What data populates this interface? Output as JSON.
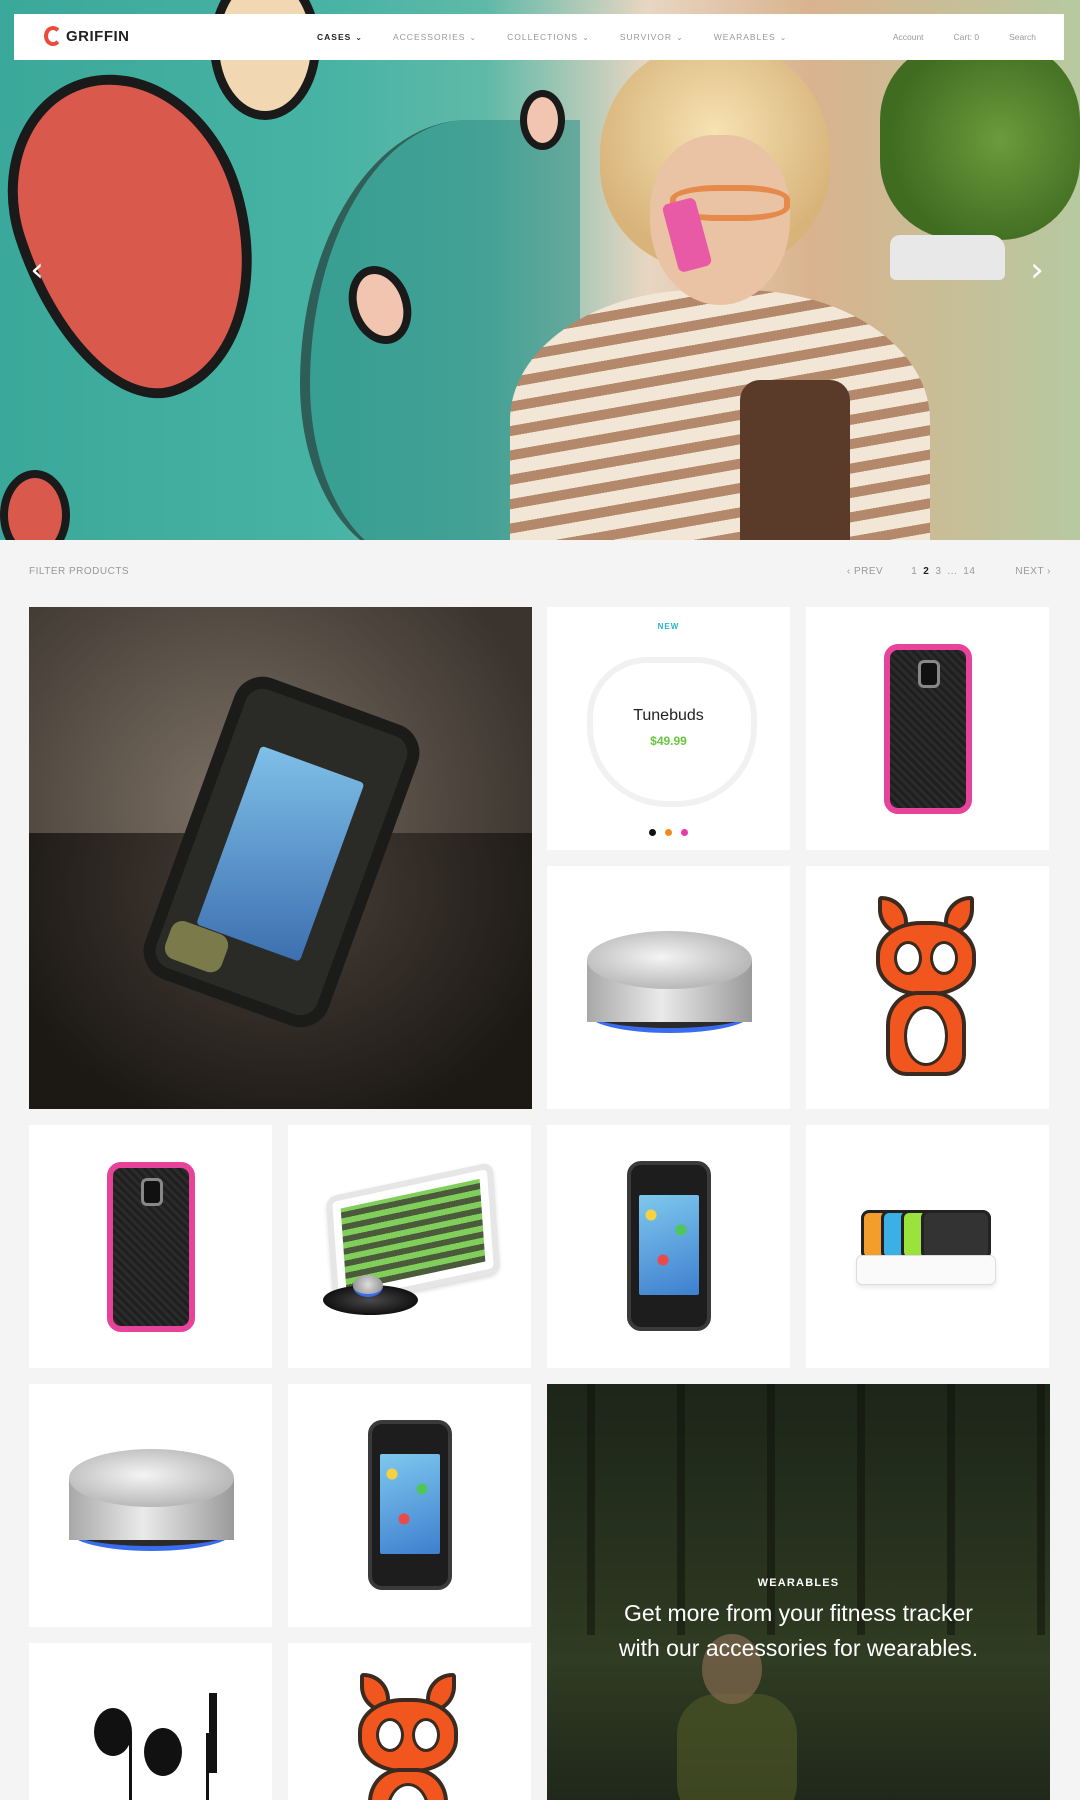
{
  "brand": {
    "name": "GRIFFIN",
    "accent": "#ea4b3a"
  },
  "nav": {
    "items": [
      {
        "label": "CASES",
        "active": true
      },
      {
        "label": "ACCESSORIES",
        "active": false
      },
      {
        "label": "COLLECTIONS",
        "active": false
      },
      {
        "label": "SURVIVOR",
        "active": false
      },
      {
        "label": "WEARABLES",
        "active": false
      }
    ],
    "account": "Account",
    "cart": "Cart: 0",
    "search": "Search"
  },
  "hero": {
    "prev_icon": "chevron-left-icon",
    "next_icon": "chevron-right-icon"
  },
  "filter": {
    "label": "FILTER PRODUCTS",
    "prev": "PREV",
    "pages": [
      "1",
      "2",
      "3",
      "...",
      "14"
    ],
    "current_page": "2",
    "next": "NEXT"
  },
  "featured_product": {
    "badge": "NEW",
    "name": "Tunebuds",
    "price": "$49.99",
    "swatches": [
      "#111111",
      "#f28a1c",
      "#e83aa8"
    ]
  },
  "promo": {
    "label": "WEARABLES",
    "headline_line1": "Get more from your fitness tracker",
    "headline_line2": "with our accessories for wearables."
  }
}
